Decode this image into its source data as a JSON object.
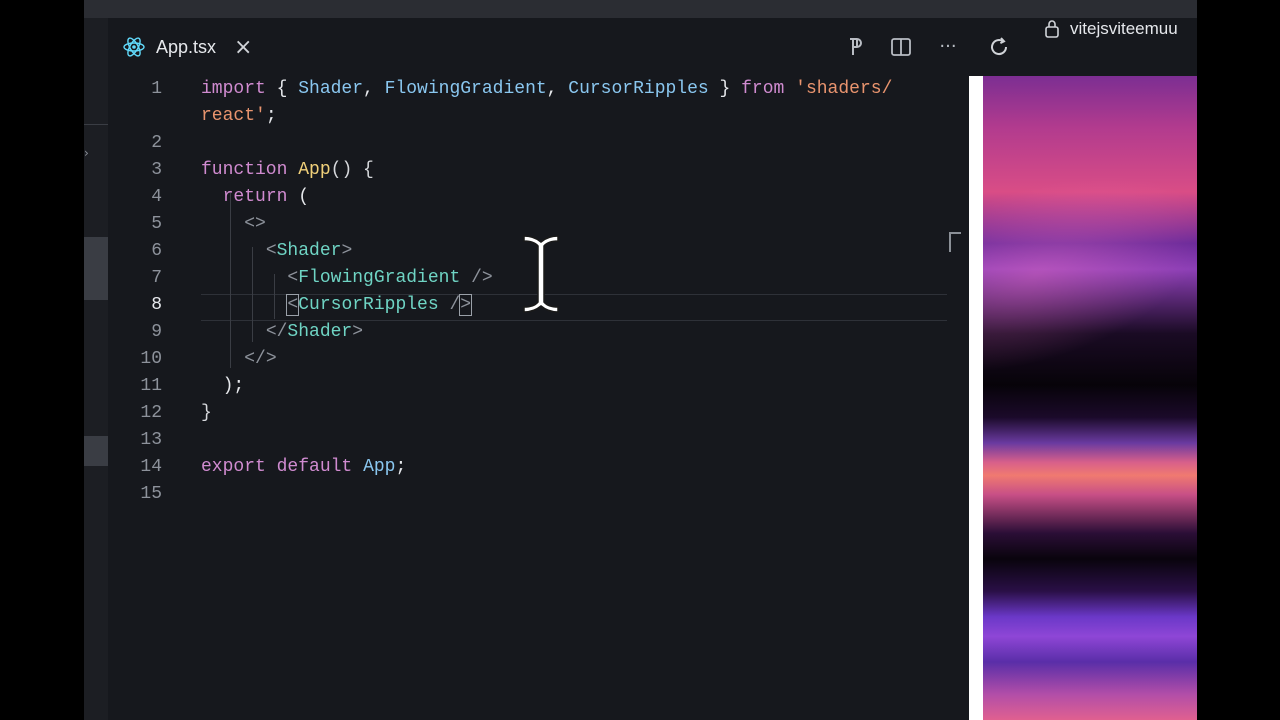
{
  "tab": {
    "title": "App.tsx",
    "icon": "react-icon",
    "close_label": "×"
  },
  "toolbar": {
    "icons": [
      "paragraph-icon",
      "split-editor-icon",
      "more-icon",
      "refresh-icon",
      "lock-icon"
    ],
    "more_label": "···",
    "address": "vitejsviteemuu"
  },
  "editor": {
    "active_line": 8,
    "lines": [
      {
        "n": "1",
        "tokens": [
          [
            "kw",
            "import"
          ],
          [
            "pun",
            " { "
          ],
          [
            "id",
            "Shader"
          ],
          [
            "pun",
            ", "
          ],
          [
            "id",
            "FlowingGradient"
          ],
          [
            "pun",
            ", "
          ],
          [
            "id",
            "CursorRipples"
          ],
          [
            "pun",
            " } "
          ],
          [
            "kw",
            "from"
          ],
          [
            "pun",
            " "
          ],
          [
            "str",
            "'shaders/"
          ]
        ]
      },
      {
        "n": "",
        "tokens": [
          [
            "str",
            "react'"
          ],
          [
            "pun",
            ";"
          ]
        ]
      },
      {
        "n": "2",
        "tokens": []
      },
      {
        "n": "3",
        "tokens": [
          [
            "kw2",
            "function"
          ],
          [
            "pun",
            " "
          ],
          [
            "fn",
            "App"
          ],
          [
            "br",
            "() {"
          ]
        ]
      },
      {
        "n": "4",
        "tokens": [
          [
            "pun",
            "  "
          ],
          [
            "kw",
            "return"
          ],
          [
            "pun",
            " ("
          ]
        ]
      },
      {
        "n": "5",
        "tokens": [
          [
            "pun",
            "    "
          ],
          [
            "gray",
            "<>"
          ]
        ]
      },
      {
        "n": "6",
        "tokens": [
          [
            "pun",
            "      "
          ],
          [
            "gray",
            "<"
          ],
          [
            "tag",
            "Shader"
          ],
          [
            "gray",
            ">"
          ]
        ]
      },
      {
        "n": "7",
        "tokens": [
          [
            "pun",
            "        "
          ],
          [
            "gray",
            "<"
          ],
          [
            "tag",
            "FlowingGradient"
          ],
          [
            "gray",
            " />"
          ]
        ]
      },
      {
        "n": "8",
        "tokens": [
          [
            "pun",
            "        "
          ],
          [
            "gray",
            "<"
          ],
          [
            "tag",
            "CursorRipples"
          ],
          [
            "gray",
            " /"
          ],
          [
            "gray",
            ">"
          ]
        ]
      },
      {
        "n": "9",
        "tokens": [
          [
            "pun",
            "      "
          ],
          [
            "gray",
            "</"
          ],
          [
            "tag",
            "Shader"
          ],
          [
            "gray",
            ">"
          ]
        ]
      },
      {
        "n": "10",
        "tokens": [
          [
            "pun",
            "    "
          ],
          [
            "gray",
            "</>"
          ]
        ]
      },
      {
        "n": "11",
        "tokens": [
          [
            "pun",
            "  );"
          ]
        ]
      },
      {
        "n": "12",
        "tokens": [
          [
            "br",
            "}"
          ]
        ]
      },
      {
        "n": "13",
        "tokens": []
      },
      {
        "n": "14",
        "tokens": [
          [
            "kw",
            "export"
          ],
          [
            "pun",
            " "
          ],
          [
            "kw",
            "default"
          ],
          [
            "pun",
            " "
          ],
          [
            "id",
            "App"
          ],
          [
            "pun",
            ";"
          ]
        ]
      },
      {
        "n": "15",
        "tokens": []
      }
    ]
  },
  "colors": {
    "editor_bg": "#16181d",
    "keyword": "#d08bd0",
    "identifier": "#8ac7f0",
    "string": "#e9946e",
    "tag": "#6fd4c4",
    "function": "#f0d07a"
  }
}
